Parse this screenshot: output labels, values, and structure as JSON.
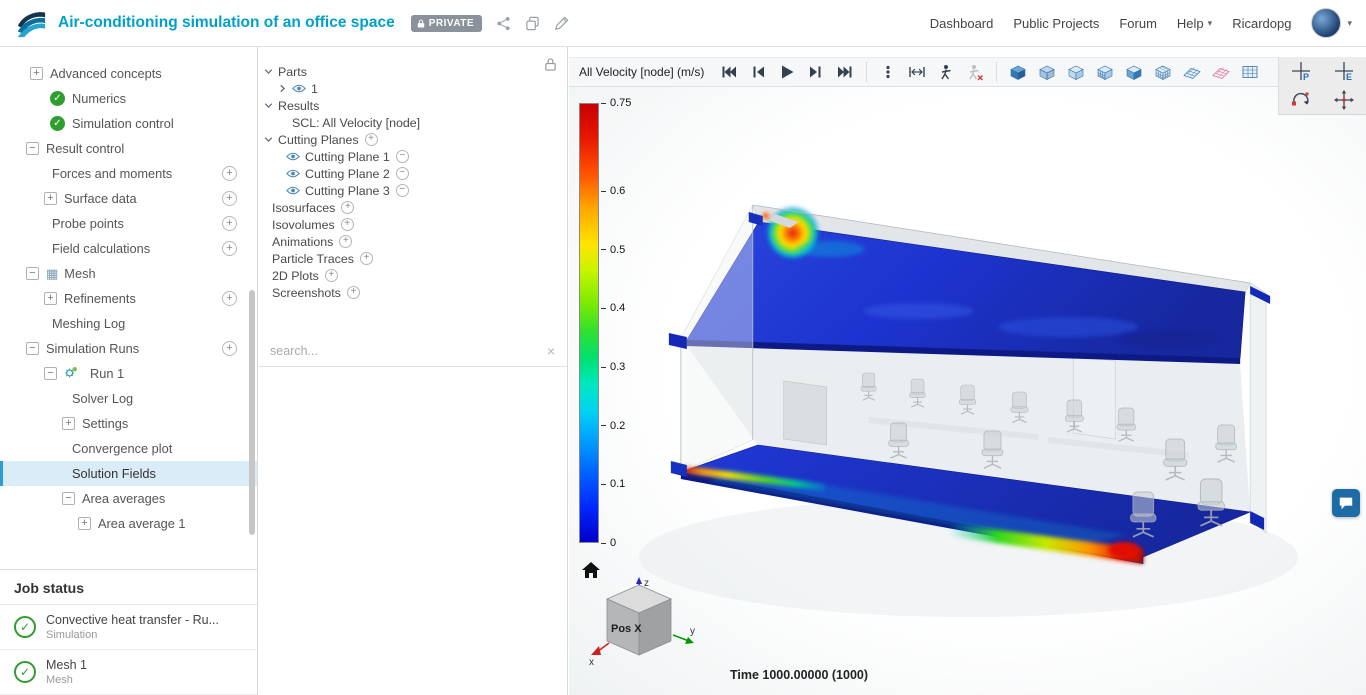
{
  "header": {
    "title": "Air-conditioning simulation of an office space",
    "privacy_badge": "PRIVATE",
    "nav": [
      {
        "label": "Dashboard"
      },
      {
        "label": "Public Projects"
      },
      {
        "label": "Forum"
      },
      {
        "label": "Help",
        "caret": true
      },
      {
        "label": "Ricardopg"
      }
    ]
  },
  "sim_tree": {
    "items": [
      {
        "label": "Advanced concepts",
        "indent": 30,
        "lead": "plus"
      },
      {
        "label": "Numerics",
        "indent": 50,
        "lead": "check"
      },
      {
        "label": "Simulation control",
        "indent": 50,
        "lead": "check"
      },
      {
        "label": "Result control",
        "indent": 26,
        "lead": "minus"
      },
      {
        "label": "Forces and moments",
        "indent": 52,
        "trail": true
      },
      {
        "label": "Surface data",
        "indent": 44,
        "lead": "plus",
        "trail": true
      },
      {
        "label": "Probe points",
        "indent": 52,
        "trail": true
      },
      {
        "label": "Field calculations",
        "indent": 52,
        "trail": true
      },
      {
        "label": "Mesh",
        "indent": 26,
        "lead": "minus",
        "icon": "mesh"
      },
      {
        "label": "Refinements",
        "indent": 44,
        "lead": "plus",
        "trail": true
      },
      {
        "label": "Meshing Log",
        "indent": 52
      },
      {
        "label": "Simulation Runs",
        "indent": 26,
        "lead": "minus",
        "trail": true
      },
      {
        "label": "Run 1",
        "indent": 44,
        "lead": "minus",
        "icon": "gear"
      },
      {
        "label": "Solver Log",
        "indent": 72
      },
      {
        "label": "Settings",
        "indent": 62,
        "lead": "plus"
      },
      {
        "label": "Convergence plot",
        "indent": 72
      },
      {
        "label": "Solution Fields",
        "indent": 72,
        "selected": true
      },
      {
        "label": "Area averages",
        "indent": 62,
        "lead": "minus"
      },
      {
        "label": "Area average 1",
        "indent": 78,
        "lead": "plus"
      }
    ]
  },
  "job_status": {
    "title": "Job status",
    "items": [
      {
        "title": "Convective heat transfer - Ru...",
        "subtitle": "Simulation"
      },
      {
        "title": "Mesh 1",
        "subtitle": "Mesh"
      }
    ]
  },
  "scene_panel": {
    "search_placeholder": "search...",
    "clear_label": "×",
    "items": [
      {
        "label": "Parts",
        "indent": 6,
        "lead": "down"
      },
      {
        "label": "1",
        "indent": 20,
        "lead": "right",
        "eye": true
      },
      {
        "label": "Results",
        "indent": 6,
        "lead": "down"
      },
      {
        "label": "SCL: All Velocity [node]",
        "indent": 34
      },
      {
        "label": "Cutting Planes",
        "indent": 6,
        "lead": "down",
        "trail": "plus"
      },
      {
        "label": "Cutting Plane 1",
        "indent": 28,
        "eye": true,
        "trail": "minus"
      },
      {
        "label": "Cutting Plane 2",
        "indent": 28,
        "eye": true,
        "trail": "minus"
      },
      {
        "label": "Cutting Plane 3",
        "indent": 28,
        "eye": true,
        "trail": "minus"
      },
      {
        "label": "Isosurfaces",
        "indent": 14,
        "trail": "plus"
      },
      {
        "label": "Isovolumes",
        "indent": 14,
        "trail": "plus"
      },
      {
        "label": "Animations",
        "indent": 14,
        "trail": "plus"
      },
      {
        "label": "Particle Traces",
        "indent": 14,
        "trail": "plus"
      },
      {
        "label": "2D Plots",
        "indent": 14,
        "trail": "plus"
      },
      {
        "label": "Screenshots",
        "indent": 14,
        "trail": "plus"
      }
    ]
  },
  "viewport": {
    "field_label": "All Velocity [node] (m/s)",
    "time_label": "Time 1000.00000 (1000)",
    "playback": [
      "skip-to-start",
      "previous-frame",
      "play",
      "next-frame",
      "skip-to-end"
    ],
    "tools": [
      "more-options",
      "fit-width",
      "walk-mode",
      "walk-mode-disabled"
    ],
    "view_modes": [
      "solid-view",
      "translucent-view",
      "light-cube-view",
      "grid-cube-view",
      "shaded-cube-view",
      "dense-grid-cube-view",
      "plane-grid-view",
      "red-grid-view",
      "table-grid-view"
    ],
    "snap_tools": [
      "pick-point-p",
      "pick-point-e",
      "rotate-gizmo",
      "pan-gizmo"
    ],
    "legend": {
      "unit_max": 0.75,
      "ticks": [
        "0.75",
        "0.6",
        "0.5",
        "0.4",
        "0.3",
        "0.2",
        "0.1",
        "0"
      ],
      "colors": [
        {
          "p": 0,
          "c": "#0000c8"
        },
        {
          "p": 8,
          "c": "#0028ff"
        },
        {
          "p": 16,
          "c": "#0064ff"
        },
        {
          "p": 24,
          "c": "#00a4ff"
        },
        {
          "p": 30,
          "c": "#00d4f0"
        },
        {
          "p": 36,
          "c": "#00e8c0"
        },
        {
          "p": 42,
          "c": "#00e070"
        },
        {
          "p": 48,
          "c": "#30e030"
        },
        {
          "p": 55,
          "c": "#80ec00"
        },
        {
          "p": 62,
          "c": "#c8f400"
        },
        {
          "p": 68,
          "c": "#ffe400"
        },
        {
          "p": 76,
          "c": "#ffa800"
        },
        {
          "p": 84,
          "c": "#ff5400"
        },
        {
          "p": 92,
          "c": "#e81800"
        },
        {
          "p": 100,
          "c": "#c80000"
        }
      ]
    },
    "nav_cube": {
      "front_label": "Pos X",
      "axes": [
        "x",
        "y",
        "z"
      ]
    }
  }
}
